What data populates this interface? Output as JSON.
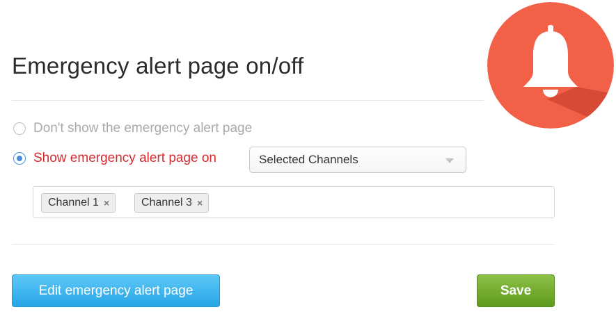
{
  "page": {
    "title": "Emergency alert page on/off"
  },
  "options": [
    {
      "label": "Don't show the emergency alert page",
      "selected": false
    },
    {
      "label": "Show emergency alert page on",
      "selected": true
    }
  ],
  "channel_select": {
    "value": "Selected Channels"
  },
  "selected_channels": [
    {
      "label": "Channel 1",
      "remove_icon": "×"
    },
    {
      "label": "Channel 3",
      "remove_icon": "×"
    }
  ],
  "buttons": {
    "edit_label": "Edit emergency alert page",
    "save_label": "Save"
  },
  "colors": {
    "accent_blue": "#4a90d9",
    "alert_red": "#d52b2f",
    "edit_button": "#27a5e6",
    "save_button": "#5e9a1c",
    "badge": "#f26048"
  },
  "icons": {
    "badge": "bell-icon",
    "dropdown": "chevron-down-icon",
    "tag_remove": "close-icon"
  }
}
